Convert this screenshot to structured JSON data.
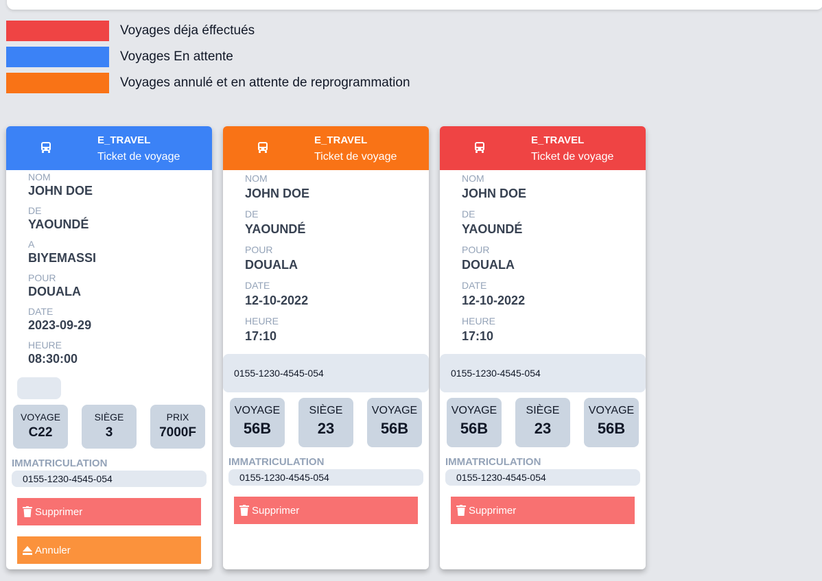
{
  "legend": [
    {
      "color": "#ef4444",
      "label": "Voyages déja éffectués"
    },
    {
      "color": "#3b82f6",
      "label": "Voyages En attente"
    },
    {
      "color": "#f97316",
      "label": "Voyages annulé et en attente de reprogrammation"
    }
  ],
  "cards": [
    {
      "header_color": "#3b82f6",
      "brand": "E_TRAVEL",
      "subtitle": "Ticket de voyage",
      "fields": [
        {
          "label": "NOM",
          "value": "JOHN DOE"
        },
        {
          "label": "DE",
          "value": "YAOUNDÉ"
        },
        {
          "label": "A",
          "value": "BIYEMASSI"
        },
        {
          "label": "POUR",
          "value": "DOUALA"
        },
        {
          "label": "DATE",
          "value": "2023-09-29"
        },
        {
          "label": "HEURE",
          "value": "08:30:00"
        }
      ],
      "stats": [
        {
          "label": "VOYAGE",
          "value": "C22"
        },
        {
          "label": "SIÈGE",
          "value": "3"
        },
        {
          "label": "PRIX",
          "value": "7000F"
        }
      ],
      "immatriculation_label": "IMMATRICULATION",
      "immatriculation": "0155-1230-4545-054",
      "delete_label": "Supprimer",
      "cancel_label": "Annuler"
    },
    {
      "header_color": "#f97316",
      "brand": "E_TRAVEL",
      "subtitle": "Ticket de voyage",
      "fields": [
        {
          "label": "NOM",
          "value": "JOHN DOE"
        },
        {
          "label": "DE",
          "value": "YAOUNDÉ"
        },
        {
          "label": "POUR",
          "value": "DOUALA"
        },
        {
          "label": "DATE",
          "value": "12-10-2022"
        },
        {
          "label": "HEURE",
          "value": "17:10"
        }
      ],
      "bar_text": "0155-1230-4545-054",
      "stats": [
        {
          "label": "VOYAGE",
          "value": "56B"
        },
        {
          "label": "SIÈGE",
          "value": "23"
        },
        {
          "label": "VOYAGE",
          "value": "56B"
        }
      ],
      "immatriculation_label": "IMMATRICULATION",
      "immatriculation": "0155-1230-4545-054",
      "delete_label": "Supprimer"
    },
    {
      "header_color": "#ef4444",
      "brand": "E_TRAVEL",
      "subtitle": "Ticket de voyage",
      "fields": [
        {
          "label": "NOM",
          "value": "JOHN DOE"
        },
        {
          "label": "DE",
          "value": "YAOUNDÉ"
        },
        {
          "label": "POUR",
          "value": "DOUALA"
        },
        {
          "label": "DATE",
          "value": "12-10-2022"
        },
        {
          "label": "HEURE",
          "value": "17:10"
        }
      ],
      "bar_text": "0155-1230-4545-054",
      "stats": [
        {
          "label": "VOYAGE",
          "value": "56B"
        },
        {
          "label": "SIÈGE",
          "value": "23"
        },
        {
          "label": "VOYAGE",
          "value": "56B"
        }
      ],
      "immatriculation_label": "IMMATRICULATION",
      "immatriculation": "0155-1230-4545-054",
      "delete_label": "Supprimer"
    }
  ]
}
